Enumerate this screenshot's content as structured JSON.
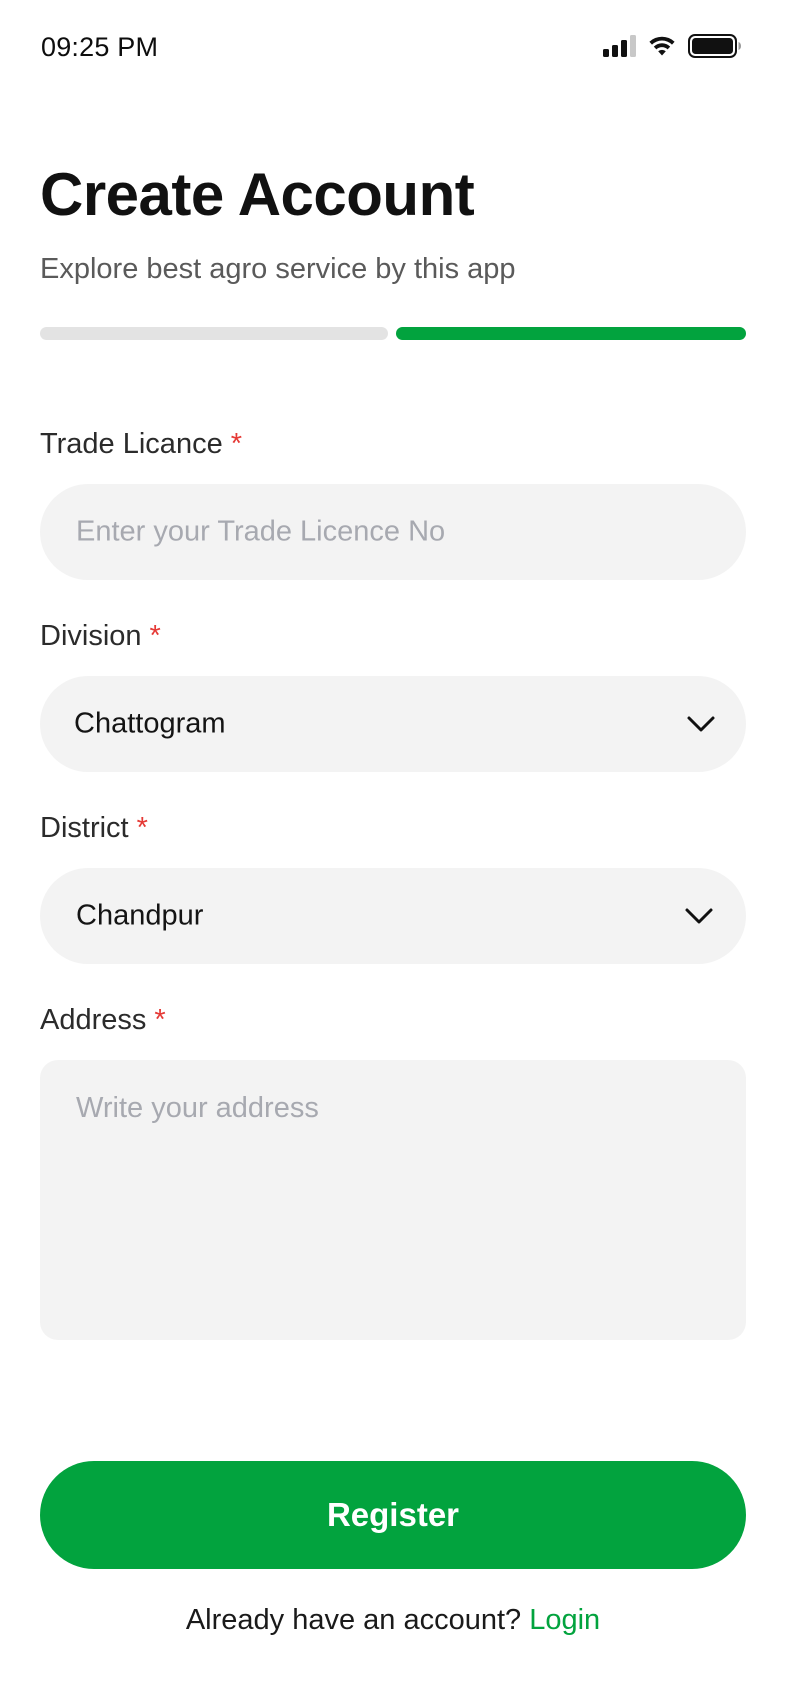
{
  "status_bar": {
    "time": "09:25 PM",
    "icons": [
      "cellular-signal-icon",
      "wifi-icon",
      "battery-icon"
    ]
  },
  "header": {
    "title": "Create Account",
    "subtitle": "Explore best agro service by this app"
  },
  "progress": {
    "total_steps": 2,
    "current_step": 2,
    "colors": {
      "active": "#02A33E",
      "inactive": "#E3E3E3"
    }
  },
  "form": {
    "required_mark": "*",
    "trade_licence": {
      "label": "Trade Licance",
      "placeholder": "Enter your Trade Licence No",
      "value": ""
    },
    "division": {
      "label": "Division",
      "selected": "Chattogram"
    },
    "district": {
      "label": "District",
      "selected": "Chandpur"
    },
    "address": {
      "label": "Address",
      "placeholder": "Write your address",
      "value": ""
    }
  },
  "actions": {
    "register_label": "Register"
  },
  "footer": {
    "prompt": "Already have an account?",
    "login_label": "Login"
  },
  "colors": {
    "brand_green": "#02A33E",
    "required_red": "#E53935",
    "field_bg": "#F3F3F3",
    "placeholder": "#A7A9B0"
  }
}
